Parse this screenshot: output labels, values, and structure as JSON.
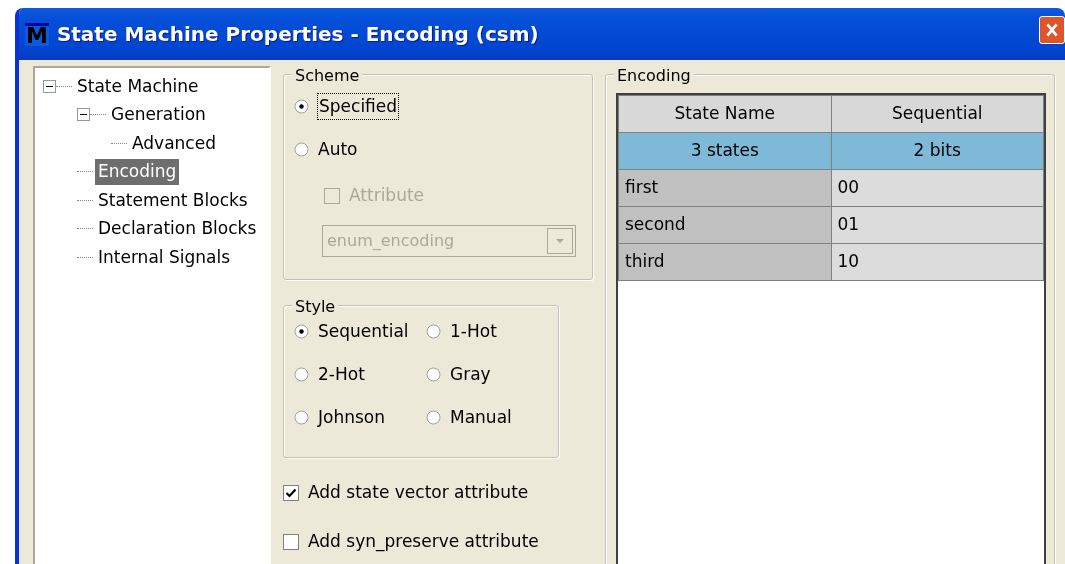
{
  "window": {
    "logo": "M",
    "title": "State Machine Properties - Encoding (csm)"
  },
  "tree": [
    {
      "label": "State Machine",
      "expanded": true,
      "selected": false,
      "children": [
        {
          "label": "Generation",
          "expanded": true,
          "selected": false,
          "children": [
            {
              "label": "Advanced",
              "selected": false
            }
          ]
        },
        {
          "label": "Encoding",
          "selected": true
        },
        {
          "label": "Statement Blocks",
          "selected": false
        },
        {
          "label": "Declaration Blocks",
          "selected": false
        },
        {
          "label": "Internal Signals",
          "selected": false
        }
      ]
    }
  ],
  "scheme": {
    "title": "Scheme",
    "options": [
      {
        "label": "Specified",
        "selected": true
      },
      {
        "label": "Auto",
        "selected": false
      }
    ],
    "attribute": {
      "label": "Attribute",
      "checked": false,
      "disabled": true
    },
    "dropdown": {
      "value": "enum_encoding",
      "disabled": true
    }
  },
  "style": {
    "title": "Style",
    "options": [
      {
        "label": "Sequential",
        "selected": true
      },
      {
        "label": "1-Hot",
        "selected": false
      },
      {
        "label": "2-Hot",
        "selected": false
      },
      {
        "label": "Gray",
        "selected": false
      },
      {
        "label": "Johnson",
        "selected": false
      },
      {
        "label": "Manual",
        "selected": false
      }
    ]
  },
  "checkboxes": [
    {
      "label": "Add state vector attribute",
      "checked": true
    },
    {
      "label": "Add syn_preserve attribute",
      "checked": false
    }
  ],
  "encoding": {
    "title": "Encoding",
    "columns": [
      "State Name",
      "Sequential"
    ],
    "summary": [
      "3 states",
      "2 bits"
    ],
    "rows": [
      [
        "first",
        "00"
      ],
      [
        "second",
        "01"
      ],
      [
        "third",
        "10"
      ]
    ]
  }
}
